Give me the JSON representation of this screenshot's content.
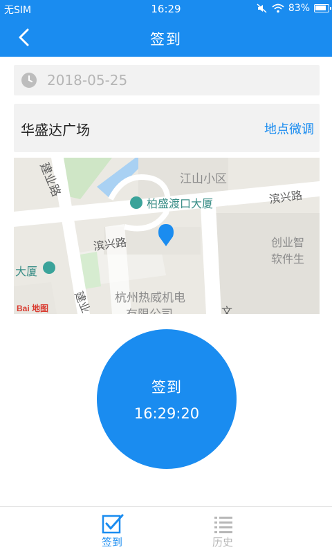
{
  "status_bar": {
    "carrier": "无SIM",
    "time": "16:29",
    "battery": "83%"
  },
  "app_bar": {
    "title": "签到"
  },
  "date_field": {
    "value": "2018-05-25"
  },
  "location": {
    "name": "华盛达广场",
    "adjust_label": "地点微调"
  },
  "map": {
    "labels": {
      "jianye_road": "建业路",
      "jiangshan": "江山小区",
      "binxing_road_right": "滨兴路",
      "bosheng": "柏盛渡口大厦",
      "binxing_road_left": "滨兴路",
      "chuangye_line1": "创业智",
      "chuangye_line2": "软件生",
      "dasha": "大厦",
      "hangzhou_line1": "杭州热威机电",
      "hangzhou_line2": "有限公司",
      "jianye_road_bottom": "建业",
      "wen": "文",
      "logo": "Bai 地图"
    }
  },
  "checkin_button": {
    "label": "签到",
    "time": "16:29:20"
  },
  "bottom_nav": {
    "items": [
      {
        "label": "签到",
        "active": true
      },
      {
        "label": "历史",
        "active": false
      }
    ]
  },
  "colors": {
    "primary": "#1a8cf0",
    "field_bg": "#f2f2f2",
    "inactive": "#b7b7b7"
  }
}
